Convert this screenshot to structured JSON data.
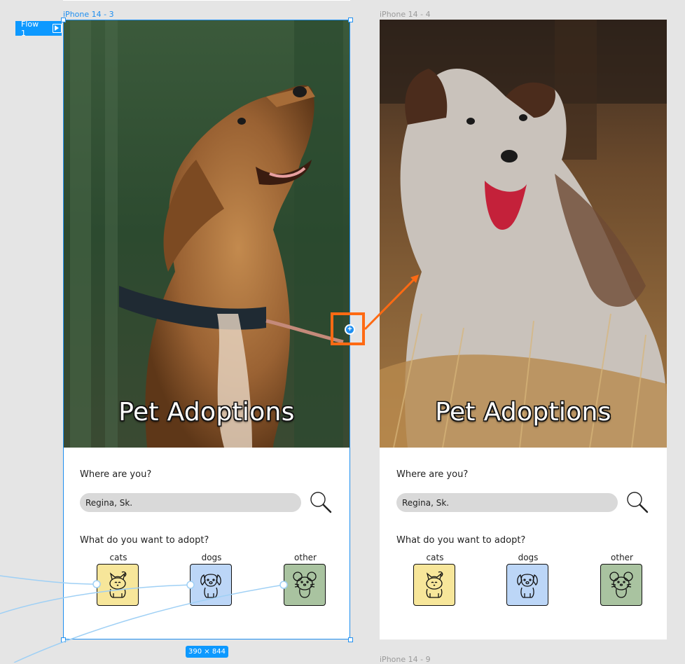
{
  "canvas": {
    "frames": [
      {
        "label": "iPhone 14 - 3",
        "title": "Pet Adoptions",
        "question1": "Where are you?",
        "location": "Regina, Sk.",
        "question2": "What do you want to adopt?",
        "pets": [
          {
            "label": "cats",
            "color": "#f7e69a",
            "icon": "cat-icon"
          },
          {
            "label": "dogs",
            "color": "#bcd6f7",
            "icon": "dog-icon"
          },
          {
            "label": "other",
            "color": "#a9c3a0",
            "icon": "mouse-icon"
          }
        ]
      },
      {
        "label": "iPhone 14 - 4",
        "title": "Pet Adoptions",
        "question1": "Where are you?",
        "location": "Regina, Sk.",
        "question2": "What do you want to adopt?",
        "pets": [
          {
            "label": "cats",
            "color": "#f7e69a",
            "icon": "cat-icon"
          },
          {
            "label": "dogs",
            "color": "#bcd6f7",
            "icon": "dog-icon"
          },
          {
            "label": "other",
            "color": "#a9c3a0",
            "icon": "mouse-icon"
          }
        ]
      }
    ],
    "below_frame_label": "iPhone 14 - 9",
    "flow_tag": "Flow 1",
    "dimensions_badge": "390 × 844",
    "accent_color": "#0d99ff",
    "hotspot_color": "#ff6a13"
  }
}
